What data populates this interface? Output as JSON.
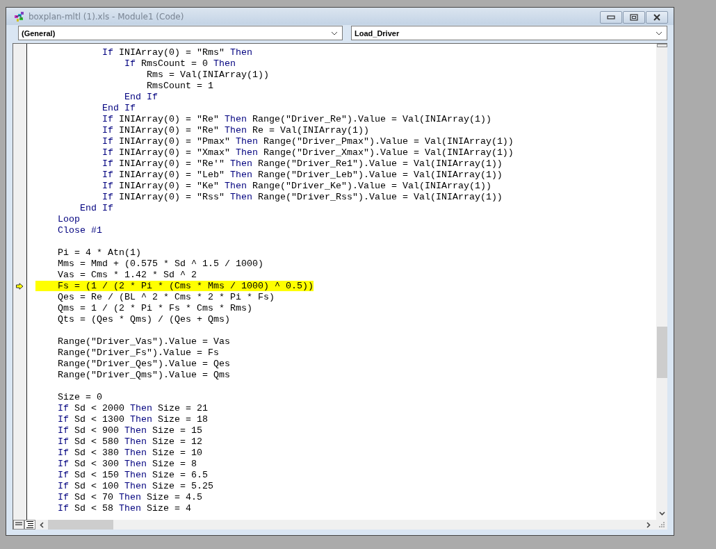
{
  "window": {
    "title": "boxplan-mltl (1).xls - Module1 (Code)"
  },
  "object_dropdown": {
    "value": "(General)"
  },
  "procedure_dropdown": {
    "value": "Load_Driver"
  },
  "code_lines": [
    {
      "kind": "code",
      "highlighted": false,
      "execution_point": false,
      "segments": [
        {
          "text": "            If",
          "keyword": true
        },
        {
          "text": " INIArray(0) = \"Rms\" ",
          "keyword": false
        },
        {
          "text": "Then",
          "keyword": true
        }
      ]
    },
    {
      "kind": "code",
      "highlighted": false,
      "execution_point": false,
      "segments": [
        {
          "text": "                If",
          "keyword": true
        },
        {
          "text": " RmsCount = 0 ",
          "keyword": false
        },
        {
          "text": "Then",
          "keyword": true
        }
      ]
    },
    {
      "kind": "code",
      "highlighted": false,
      "execution_point": false,
      "segments": [
        {
          "text": "                    Rms = Val(INIArray(1))",
          "keyword": false
        }
      ]
    },
    {
      "kind": "code",
      "highlighted": false,
      "execution_point": false,
      "segments": [
        {
          "text": "                    RmsCount = 1",
          "keyword": false
        }
      ]
    },
    {
      "kind": "code",
      "highlighted": false,
      "execution_point": false,
      "segments": [
        {
          "text": "                End If",
          "keyword": true
        }
      ]
    },
    {
      "kind": "code",
      "highlighted": false,
      "execution_point": false,
      "segments": [
        {
          "text": "            End If",
          "keyword": true
        }
      ]
    },
    {
      "kind": "code",
      "highlighted": false,
      "execution_point": false,
      "segments": [
        {
          "text": "            If",
          "keyword": true
        },
        {
          "text": " INIArray(0) = \"Re\" ",
          "keyword": false
        },
        {
          "text": "Then",
          "keyword": true
        },
        {
          "text": " Range(\"Driver_Re\").Value = Val(INIArray(1))",
          "keyword": false
        }
      ]
    },
    {
      "kind": "code",
      "highlighted": false,
      "execution_point": false,
      "segments": [
        {
          "text": "            If",
          "keyword": true
        },
        {
          "text": " INIArray(0) = \"Re\" ",
          "keyword": false
        },
        {
          "text": "Then",
          "keyword": true
        },
        {
          "text": " Re = Val(INIArray(1))",
          "keyword": false
        }
      ]
    },
    {
      "kind": "code",
      "highlighted": false,
      "execution_point": false,
      "segments": [
        {
          "text": "            If",
          "keyword": true
        },
        {
          "text": " INIArray(0) = \"Pmax\" ",
          "keyword": false
        },
        {
          "text": "Then",
          "keyword": true
        },
        {
          "text": " Range(\"Driver_Pmax\").Value = Val(INIArray(1))",
          "keyword": false
        }
      ]
    },
    {
      "kind": "code",
      "highlighted": false,
      "execution_point": false,
      "segments": [
        {
          "text": "            If",
          "keyword": true
        },
        {
          "text": " INIArray(0) = \"Xmax\" ",
          "keyword": false
        },
        {
          "text": "Then",
          "keyword": true
        },
        {
          "text": " Range(\"Driver_Xmax\").Value = Val(INIArray(1))",
          "keyword": false
        }
      ]
    },
    {
      "kind": "code",
      "highlighted": false,
      "execution_point": false,
      "segments": [
        {
          "text": "            If",
          "keyword": true
        },
        {
          "text": " INIArray(0) = \"Re'\" ",
          "keyword": false
        },
        {
          "text": "Then",
          "keyword": true
        },
        {
          "text": " Range(\"Driver_Re1\").Value = Val(INIArray(1))",
          "keyword": false
        }
      ]
    },
    {
      "kind": "code",
      "highlighted": false,
      "execution_point": false,
      "segments": [
        {
          "text": "            If",
          "keyword": true
        },
        {
          "text": " INIArray(0) = \"Leb\" ",
          "keyword": false
        },
        {
          "text": "Then",
          "keyword": true
        },
        {
          "text": " Range(\"Driver_Leb\").Value = Val(INIArray(1))",
          "keyword": false
        }
      ]
    },
    {
      "kind": "code",
      "highlighted": false,
      "execution_point": false,
      "segments": [
        {
          "text": "            If",
          "keyword": true
        },
        {
          "text": " INIArray(0) = \"Ke\" ",
          "keyword": false
        },
        {
          "text": "Then",
          "keyword": true
        },
        {
          "text": " Range(\"Driver_Ke\").Value = Val(INIArray(1))",
          "keyword": false
        }
      ]
    },
    {
      "kind": "code",
      "highlighted": false,
      "execution_point": false,
      "segments": [
        {
          "text": "            If",
          "keyword": true
        },
        {
          "text": " INIArray(0) = \"Rss\" ",
          "keyword": false
        },
        {
          "text": "Then",
          "keyword": true
        },
        {
          "text": " Range(\"Driver_Rss\").Value = Val(INIArray(1))",
          "keyword": false
        }
      ]
    },
    {
      "kind": "code",
      "highlighted": false,
      "execution_point": false,
      "segments": [
        {
          "text": "        End If",
          "keyword": true
        }
      ]
    },
    {
      "kind": "code",
      "highlighted": false,
      "execution_point": false,
      "segments": [
        {
          "text": "    Loop",
          "keyword": true
        }
      ]
    },
    {
      "kind": "code",
      "highlighted": false,
      "execution_point": false,
      "segments": [
        {
          "text": "    Close #1",
          "keyword": true
        }
      ]
    },
    {
      "kind": "blank"
    },
    {
      "kind": "code",
      "highlighted": false,
      "execution_point": false,
      "segments": [
        {
          "text": "    Pi = 4 * Atn(1)",
          "keyword": false
        }
      ]
    },
    {
      "kind": "code",
      "highlighted": false,
      "execution_point": false,
      "segments": [
        {
          "text": "    Mms = Mmd + (0.575 * Sd ^ 1.5 / 1000)",
          "keyword": false
        }
      ]
    },
    {
      "kind": "code",
      "highlighted": false,
      "execution_point": false,
      "segments": [
        {
          "text": "    Vas = Cms * 1.42 * Sd ^ 2",
          "keyword": false
        }
      ]
    },
    {
      "kind": "code",
      "highlighted": true,
      "execution_point": true,
      "segments": [
        {
          "text": "    Fs = (1 / (2 * Pi * (Cms * Mms / 1000) ^ 0.5))",
          "keyword": false
        }
      ]
    },
    {
      "kind": "code",
      "highlighted": false,
      "execution_point": false,
      "segments": [
        {
          "text": "    Qes = Re / (BL ^ 2 * Cms * 2 * Pi * Fs)",
          "keyword": false
        }
      ]
    },
    {
      "kind": "code",
      "highlighted": false,
      "execution_point": false,
      "segments": [
        {
          "text": "    Qms = 1 / (2 * Pi * Fs * Cms * Rms)",
          "keyword": false
        }
      ]
    },
    {
      "kind": "code",
      "highlighted": false,
      "execution_point": false,
      "segments": [
        {
          "text": "    Qts = (Qes * Qms) / (Qes + Qms)",
          "keyword": false
        }
      ]
    },
    {
      "kind": "blank"
    },
    {
      "kind": "code",
      "highlighted": false,
      "execution_point": false,
      "segments": [
        {
          "text": "    Range(\"Driver_Vas\").Value = Vas",
          "keyword": false
        }
      ]
    },
    {
      "kind": "code",
      "highlighted": false,
      "execution_point": false,
      "segments": [
        {
          "text": "    Range(\"Driver_Fs\").Value = Fs",
          "keyword": false
        }
      ]
    },
    {
      "kind": "code",
      "highlighted": false,
      "execution_point": false,
      "segments": [
        {
          "text": "    Range(\"Driver_Qes\").Value = Qes",
          "keyword": false
        }
      ]
    },
    {
      "kind": "code",
      "highlighted": false,
      "execution_point": false,
      "segments": [
        {
          "text": "    Range(\"Driver_Qms\").Value = Qms",
          "keyword": false
        }
      ]
    },
    {
      "kind": "blank"
    },
    {
      "kind": "code",
      "highlighted": false,
      "execution_point": false,
      "segments": [
        {
          "text": "    Size = 0",
          "keyword": false
        }
      ]
    },
    {
      "kind": "code",
      "highlighted": false,
      "execution_point": false,
      "segments": [
        {
          "text": "    If",
          "keyword": true
        },
        {
          "text": " Sd < 2000 ",
          "keyword": false
        },
        {
          "text": "Then",
          "keyword": true
        },
        {
          "text": " Size = 21",
          "keyword": false
        }
      ]
    },
    {
      "kind": "code",
      "highlighted": false,
      "execution_point": false,
      "segments": [
        {
          "text": "    If",
          "keyword": true
        },
        {
          "text": " Sd < 1300 ",
          "keyword": false
        },
        {
          "text": "Then",
          "keyword": true
        },
        {
          "text": " Size = 18",
          "keyword": false
        }
      ]
    },
    {
      "kind": "code",
      "highlighted": false,
      "execution_point": false,
      "segments": [
        {
          "text": "    If",
          "keyword": true
        },
        {
          "text": " Sd < 900 ",
          "keyword": false
        },
        {
          "text": "Then",
          "keyword": true
        },
        {
          "text": " Size = 15",
          "keyword": false
        }
      ]
    },
    {
      "kind": "code",
      "highlighted": false,
      "execution_point": false,
      "segments": [
        {
          "text": "    If",
          "keyword": true
        },
        {
          "text": " Sd < 580 ",
          "keyword": false
        },
        {
          "text": "Then",
          "keyword": true
        },
        {
          "text": " Size = 12",
          "keyword": false
        }
      ]
    },
    {
      "kind": "code",
      "highlighted": false,
      "execution_point": false,
      "segments": [
        {
          "text": "    If",
          "keyword": true
        },
        {
          "text": " Sd < 380 ",
          "keyword": false
        },
        {
          "text": "Then",
          "keyword": true
        },
        {
          "text": " Size = 10",
          "keyword": false
        }
      ]
    },
    {
      "kind": "code",
      "highlighted": false,
      "execution_point": false,
      "segments": [
        {
          "text": "    If",
          "keyword": true
        },
        {
          "text": " Sd < 300 ",
          "keyword": false
        },
        {
          "text": "Then",
          "keyword": true
        },
        {
          "text": " Size = 8",
          "keyword": false
        }
      ]
    },
    {
      "kind": "code",
      "highlighted": false,
      "execution_point": false,
      "segments": [
        {
          "text": "    If",
          "keyword": true
        },
        {
          "text": " Sd < 150 ",
          "keyword": false
        },
        {
          "text": "Then",
          "keyword": true
        },
        {
          "text": " Size = 6.5",
          "keyword": false
        }
      ]
    },
    {
      "kind": "code",
      "highlighted": false,
      "execution_point": false,
      "segments": [
        {
          "text": "    If",
          "keyword": true
        },
        {
          "text": " Sd < 100 ",
          "keyword": false
        },
        {
          "text": "Then",
          "keyword": true
        },
        {
          "text": " Size = 5.25",
          "keyword": false
        }
      ]
    },
    {
      "kind": "code",
      "highlighted": false,
      "execution_point": false,
      "segments": [
        {
          "text": "    If",
          "keyword": true
        },
        {
          "text": " Sd < 70 ",
          "keyword": false
        },
        {
          "text": "Then",
          "keyword": true
        },
        {
          "text": " Size = 4.5",
          "keyword": false
        }
      ]
    },
    {
      "kind": "code",
      "highlighted": false,
      "execution_point": false,
      "segments": [
        {
          "text": "    If",
          "keyword": true
        },
        {
          "text": " Sd < 58 ",
          "keyword": false
        },
        {
          "text": "Then",
          "keyword": true
        },
        {
          "text": " Size = 4",
          "keyword": false
        }
      ]
    }
  ]
}
